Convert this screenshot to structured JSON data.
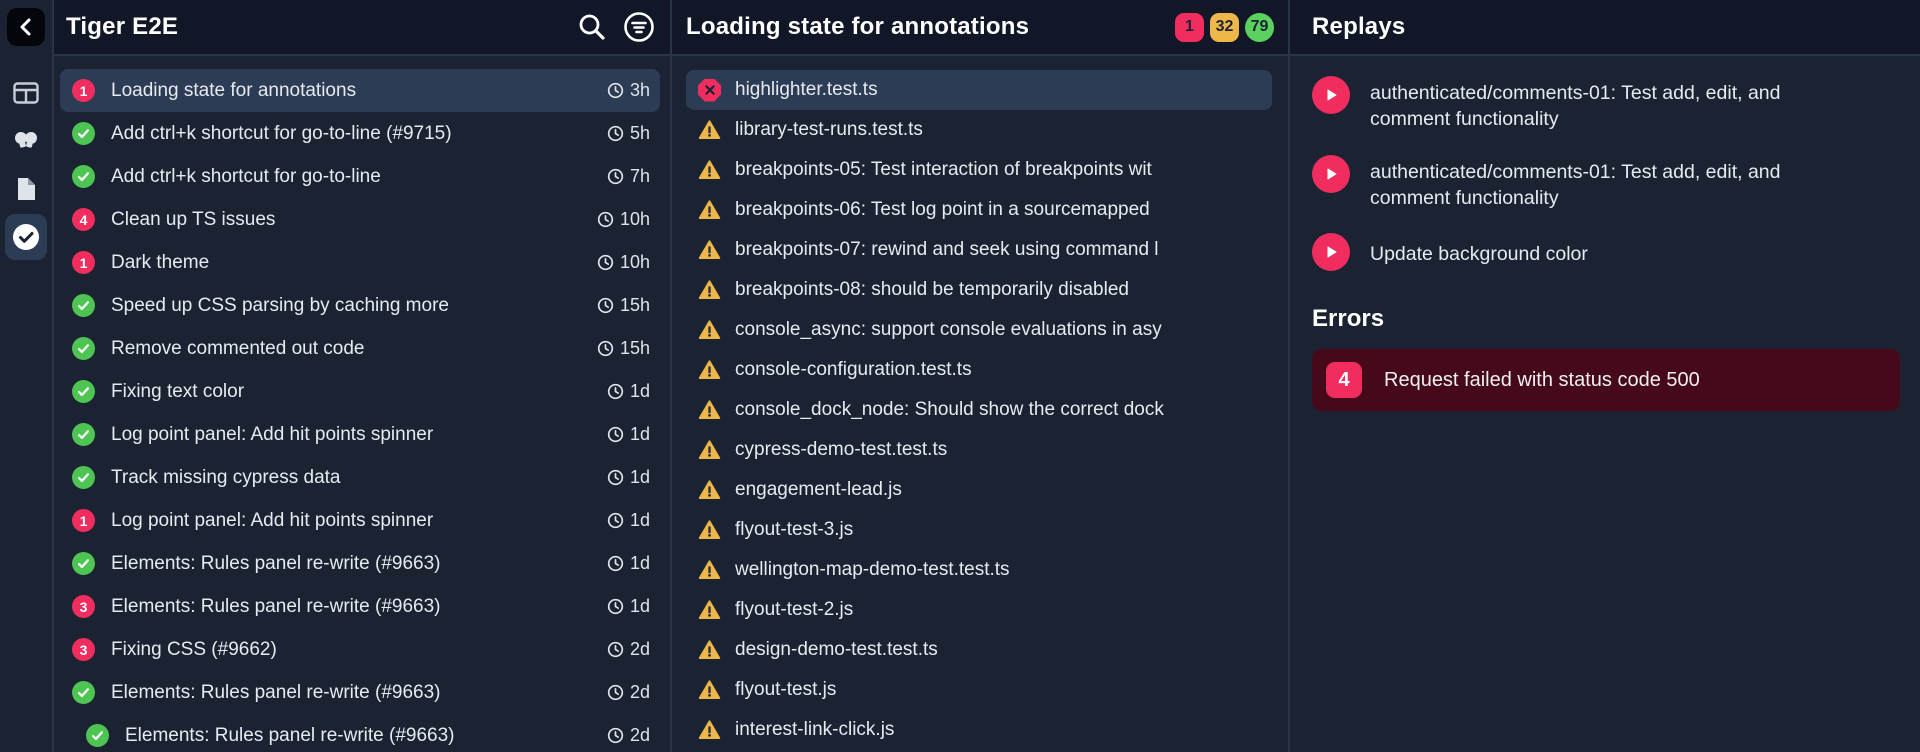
{
  "rail": {
    "back_icon": "chevron-left",
    "items": [
      {
        "icon": "layout-panels",
        "selected": false
      },
      {
        "icon": "lightbulbs",
        "selected": false
      },
      {
        "icon": "document",
        "selected": false
      },
      {
        "icon": "check-circle",
        "selected": true
      }
    ]
  },
  "tasks_panel": {
    "title": "Tiger E2E",
    "actions": {
      "search_icon": "magnifier",
      "filter_icon": "filter-circle"
    },
    "items": [
      {
        "status": "fail",
        "count": "1",
        "label": "Loading state for annotations",
        "time": "3h",
        "selected": true
      },
      {
        "status": "pass",
        "label": "Add ctrl+k shortcut for go-to-line (#9715)",
        "time": "5h"
      },
      {
        "status": "pass",
        "label": "Add ctrl+k shortcut for go-to-line",
        "time": "7h"
      },
      {
        "status": "fail",
        "count": "4",
        "label": "Clean up TS issues",
        "time": "10h"
      },
      {
        "status": "fail",
        "count": "1",
        "label": "Dark theme",
        "time": "10h"
      },
      {
        "status": "pass",
        "label": "Speed up CSS parsing by caching more",
        "time": "15h"
      },
      {
        "status": "pass",
        "label": "Remove commented out code",
        "time": "15h"
      },
      {
        "status": "pass",
        "label": "Fixing text color",
        "time": "1d"
      },
      {
        "status": "pass",
        "label": "Log point panel: Add hit points spinner",
        "time": "1d"
      },
      {
        "status": "pass",
        "label": "Track missing cypress data",
        "time": "1d"
      },
      {
        "status": "fail",
        "count": "1",
        "label": "Log point panel: Add hit points spinner",
        "time": "1d"
      },
      {
        "status": "pass",
        "label": "Elements: Rules panel re-write (#9663)",
        "time": "1d"
      },
      {
        "status": "fail",
        "count": "3",
        "label": "Elements: Rules panel re-write (#9663)",
        "time": "1d"
      },
      {
        "status": "fail",
        "count": "3",
        "label": "Fixing CSS (#9662)",
        "time": "2d"
      },
      {
        "status": "pass",
        "label": "Elements: Rules panel re-write (#9663)",
        "time": "2d"
      },
      {
        "status": "pass",
        "label": "Elements: Rules panel re-write (#9663)",
        "time": "2d",
        "indent": true
      }
    ]
  },
  "tests_panel": {
    "title": "Loading state for annotations",
    "badges": [
      {
        "value": "1",
        "color": "#f02d5e",
        "shape": "square"
      },
      {
        "value": "32",
        "color": "#efb64a",
        "shape": "square"
      },
      {
        "value": "79",
        "color": "#5bd160",
        "shape": "round"
      }
    ],
    "items": [
      {
        "status": "fail",
        "label": "highlighter.test.ts",
        "selected": true
      },
      {
        "status": "warn",
        "label": "library-test-runs.test.ts"
      },
      {
        "status": "warn",
        "label": "breakpoints-05: Test interaction of breakpoints wit"
      },
      {
        "status": "warn",
        "label": "breakpoints-06: Test log point in a sourcemapped"
      },
      {
        "status": "warn",
        "label": "breakpoints-07: rewind and seek using command l"
      },
      {
        "status": "warn",
        "label": "breakpoints-08: should be temporarily disabled"
      },
      {
        "status": "warn",
        "label": "console_async: support console evaluations in asy"
      },
      {
        "status": "warn",
        "label": "console-configuration.test.ts"
      },
      {
        "status": "warn",
        "label": "console_dock_node: Should show the correct dock"
      },
      {
        "status": "warn",
        "label": "cypress-demo-test.test.ts"
      },
      {
        "status": "warn",
        "label": "engagement-lead.js"
      },
      {
        "status": "warn",
        "label": "flyout-test-3.js"
      },
      {
        "status": "warn",
        "label": "wellington-map-demo-test.test.ts"
      },
      {
        "status": "warn",
        "label": "flyout-test-2.js"
      },
      {
        "status": "warn",
        "label": "design-demo-test.test.ts"
      },
      {
        "status": "warn",
        "label": "flyout-test.js"
      },
      {
        "status": "warn",
        "label": "interest-link-click.js"
      }
    ]
  },
  "replays_panel": {
    "title": "Replays",
    "replays": [
      {
        "label": "authenticated/comments-01: Test add, edit, and comment functionality",
        "lines": 2
      },
      {
        "label": "authenticated/comments-01: Test add, edit, and comment functionality",
        "lines": 2
      },
      {
        "label": "Update background color",
        "lines": 1
      }
    ],
    "errors": {
      "heading": "Errors",
      "items": [
        {
          "count": "4",
          "message": "Request failed with status code 500"
        }
      ]
    }
  },
  "colors": {
    "accent_pink": "#f02d5e",
    "pass_green": "#4ec553",
    "warn_amber": "#efb64a",
    "badge_green": "#5bd160",
    "selected_row": "#2b3c54",
    "error_banner_bg": "#45091a",
    "background": "#1b2332",
    "header_bg": "#111726"
  }
}
